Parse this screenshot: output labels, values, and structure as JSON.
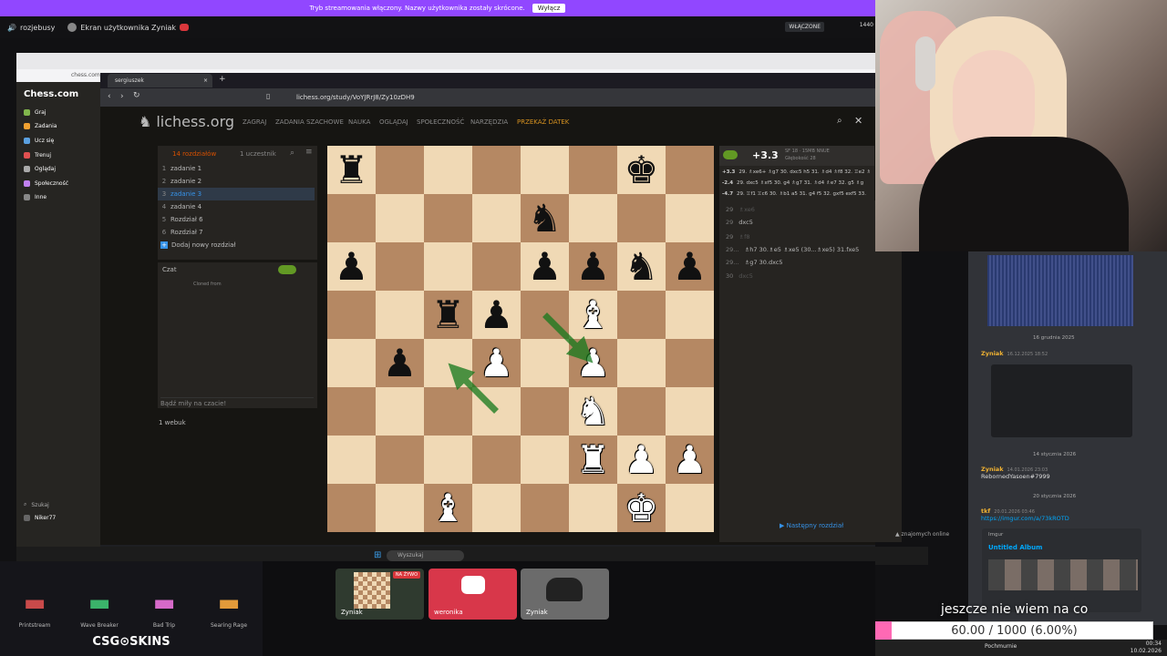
{
  "banner": {
    "text": "Tryb streamowania włączony. Nazwy użytkownika zostały skrócone.",
    "button": "Wyłącz"
  },
  "discord_header": {
    "server": "rozjebusy",
    "channel": "Ekran użytkownika Zyniak",
    "live_label": "WŁĄCZONE",
    "viewer_count": "1440"
  },
  "outer_browser": {
    "url": "chess.com"
  },
  "chesscom": {
    "logo": "Chess.com",
    "menu": [
      "Graj",
      "Zadania",
      "Ucz się",
      "Trenuj",
      "Oglądaj",
      "Społeczność",
      "Inne"
    ],
    "bottom": [
      "Szukaj",
      "Niker77"
    ]
  },
  "inner_browser": {
    "tab_title": "sergiuszek",
    "url": "lichess.org/study/VoYJRrJ8/Zy10zDH9"
  },
  "lichess": {
    "logo": "lichess.org",
    "nav": [
      "ZAGRAJ",
      "ZADANIA SZACHOWE",
      "NAUKA",
      "OGLĄDAJ",
      "SPOŁECZNOŚĆ",
      "NARZĘDZIA",
      "PRZEKAŻ DATEK"
    ],
    "study_tabs": [
      "14 rozdziałów",
      "1 uczestnik"
    ],
    "chapters": [
      {
        "n": "1",
        "name": "zadanie 1"
      },
      {
        "n": "2",
        "name": "zadanie 2"
      },
      {
        "n": "3",
        "name": "zadanie 3"
      },
      {
        "n": "4",
        "name": "zadanie 4"
      },
      {
        "n": "5",
        "name": "Rozdział 6"
      },
      {
        "n": "6",
        "name": "Rozdział 7"
      }
    ],
    "add_chapter": "Dodaj nowy rozdział",
    "chat_label": "Czat",
    "cloned_from": "Cloned from",
    "chat_placeholder": "Bądź miły na czacie!",
    "members": "1 webuk",
    "engine": {
      "eval": "+3.3",
      "info": "SF 18 · 15MB NNUE",
      "depth": "Głębokość 28"
    },
    "pv": [
      {
        "score": "+3.3",
        "moves": "29. ♗xe6+ ♗g7 30. dxc5 h5 31. ♗d4 ♗f8 32. ♖e2 ♗"
      },
      {
        "score": "-2.4",
        "moves": "29. dxc5 ♗xf5 30. g4 ♗g7 31. ♗d4 ♗e7 32. g5 ♗g"
      },
      {
        "score": "-4.7",
        "moves": "29. ♖f1 ♖c6 30. ♗b1 a5 31. g4 f5 32. gxf5 exf5 33."
      }
    ],
    "moves": [
      {
        "label": "29",
        "text": "♗xe6"
      },
      {
        "label": "29",
        "text": "dxc5"
      },
      {
        "label": "29",
        "text": "♗f8"
      },
      {
        "label": "29...",
        "text": "♗h7 30.♗e5 ♗xe5 (30...♗xe5) 31.fxe5"
      },
      {
        "label": "29...",
        "text": "♗g7 30.dxc5"
      },
      {
        "label": "30",
        "text": "dxc5"
      }
    ],
    "next_chapter": "Następny rozdział",
    "friends": "znajomych online"
  },
  "board": {
    "ranks": [
      [
        "r",
        "",
        "",
        "",
        "",
        "",
        "k",
        ""
      ],
      [
        "",
        "",
        "",
        "",
        "n",
        "",
        "",
        ""
      ],
      [
        "p",
        "",
        "",
        "",
        "p",
        "p",
        "n",
        "p"
      ],
      [
        "",
        "",
        "r",
        "p",
        "",
        "B",
        "",
        ""
      ],
      [
        "",
        "p",
        "",
        "P",
        "",
        "P",
        "",
        ""
      ],
      [
        "",
        "",
        "",
        "",
        "",
        "N",
        "",
        ""
      ],
      [
        "",
        "",
        "",
        "",
        "",
        "R",
        "P",
        "P"
      ],
      [
        "",
        "",
        "B",
        "",
        "",
        "",
        "K",
        ""
      ]
    ],
    "arrow_color": "#15781b",
    "arrows": [
      [
        "e5",
        "f4"
      ],
      [
        "d3",
        "c4"
      ]
    ]
  },
  "discord_panel": {
    "messages": [
      {
        "divider": "16 grudnia 2025"
      },
      {
        "name": "Zyniak",
        "time": "16.12.2025 18:52",
        "text": ""
      },
      {
        "divider": "14 stycznia 2026"
      },
      {
        "name": "Zyniak",
        "time": "14.01.2026 23:03",
        "text": "RebornedYasoen#7999"
      },
      {
        "divider": "20 stycznia 2026"
      },
      {
        "name": "tkf",
        "time": "20.01.2026 03:46",
        "text": "https://imgur.com/a/73kROTD"
      }
    ],
    "embed_source": "Imgur",
    "embed_title": "Untitled Album"
  },
  "taskbar": {
    "search_placeholder": "Wyszukaj"
  },
  "skins": [
    {
      "name": "Printstream",
      "icon": "rifle-icon"
    },
    {
      "name": "Wave Breaker",
      "icon": "rifle-icon"
    },
    {
      "name": "Bad Trip",
      "icon": "rifle-icon"
    },
    {
      "name": "Searing Rage",
      "icon": "rifle-icon"
    }
  ],
  "sponsor": "CSG⊙SKINS",
  "thumbnails": [
    {
      "name": "Zyniak",
      "badge": "NA ŻYWO"
    },
    {
      "name": "weronika"
    },
    {
      "name": "Zyniak"
    }
  ],
  "goal": {
    "text": "jeszcze nie wiem na co",
    "value_label": "60.00 / 1000 (6.00%)",
    "fraction": 0.06
  },
  "systray": {
    "weather": "Pochmurnie",
    "time": "00:34",
    "date": "10.02.2026"
  }
}
